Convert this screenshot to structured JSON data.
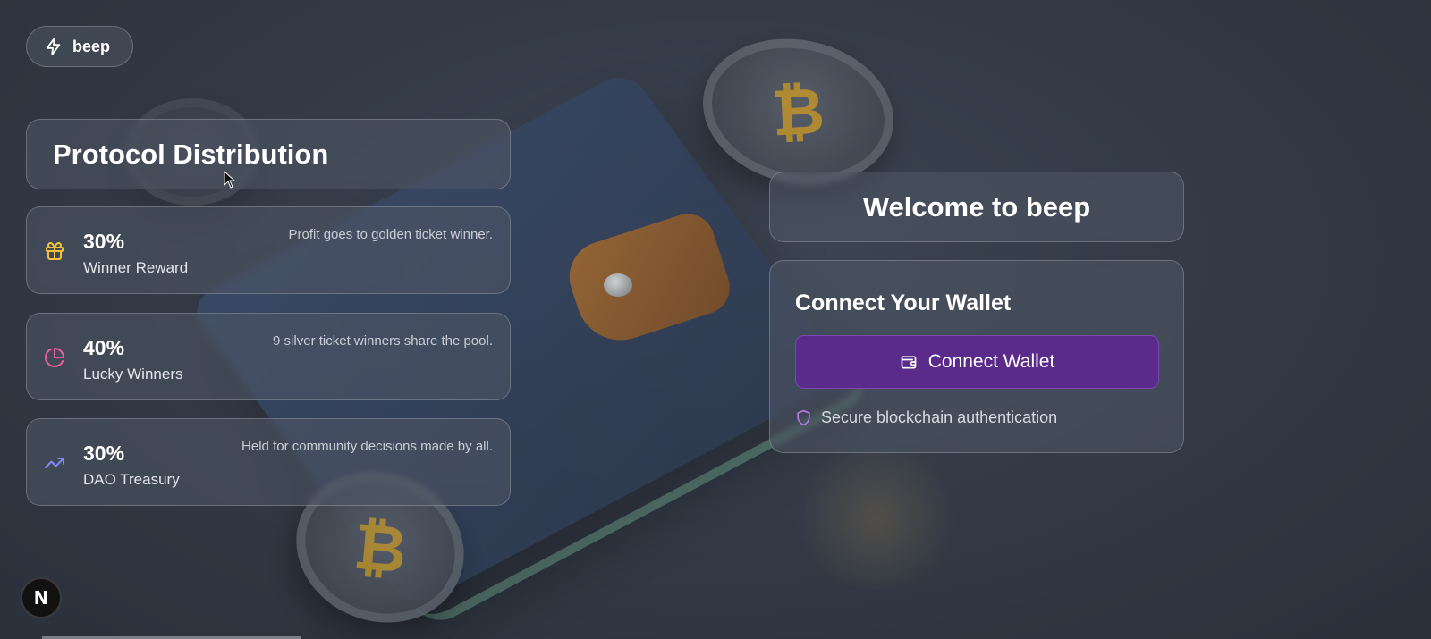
{
  "brand": {
    "name": "beep",
    "icon": "bolt-icon"
  },
  "distribution": {
    "title": "Protocol Distribution",
    "items": [
      {
        "percent": "30%",
        "label": "Winner Reward",
        "description": "Profit goes to golden ticket winner.",
        "icon": "gift-icon",
        "color": "#f2c23c"
      },
      {
        "percent": "40%",
        "label": "Lucky Winners",
        "description": "9 silver ticket winners share the pool.",
        "icon": "pie-chart-icon",
        "color": "#ec5f9a"
      },
      {
        "percent": "30%",
        "label": "DAO Treasury",
        "description": "Held for community decisions made by all.",
        "icon": "trending-up-icon",
        "color": "#7f86f5"
      }
    ]
  },
  "welcome": {
    "title": "Welcome to beep"
  },
  "connect": {
    "heading": "Connect Your Wallet",
    "button_label": "Connect Wallet",
    "secure_text": "Secure blockchain authentication",
    "button_color": "#5a2b8a",
    "shield_color": "#b97af0"
  },
  "framework_badge": {
    "letter": "N"
  }
}
